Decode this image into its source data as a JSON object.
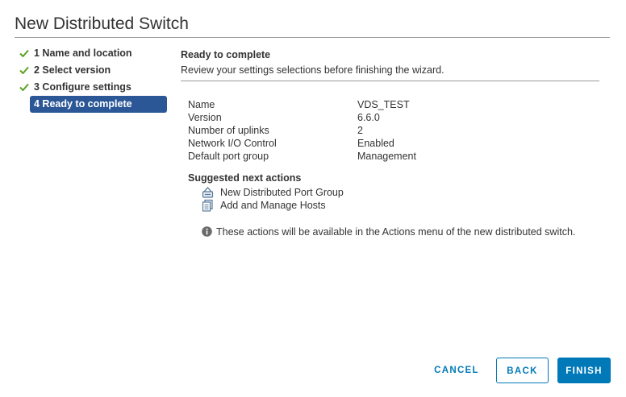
{
  "dialog": {
    "title": "New Distributed Switch"
  },
  "steps": [
    {
      "label": "1 Name and location",
      "completed": true
    },
    {
      "label": "2 Select version",
      "completed": true
    },
    {
      "label": "3 Configure settings",
      "completed": true
    },
    {
      "label": "4 Ready to complete",
      "active": true
    }
  ],
  "main": {
    "section_title": "Ready to complete",
    "section_desc": "Review your settings selections before finishing the wizard.",
    "summary": [
      {
        "key": "Name",
        "value": "VDS_TEST"
      },
      {
        "key": "Version",
        "value": "6.6.0"
      },
      {
        "key": "Number of uplinks",
        "value": "2"
      },
      {
        "key": "Network I/O Control",
        "value": "Enabled"
      },
      {
        "key": "Default port group",
        "value": "Management"
      }
    ],
    "next_actions_title": "Suggested next actions",
    "next_actions": [
      {
        "label": "New Distributed Port Group",
        "icon": "port-group-icon"
      },
      {
        "label": "Add and Manage Hosts",
        "icon": "hosts-icon"
      }
    ],
    "info_note": "These actions will be available in the Actions menu of the new distributed switch."
  },
  "buttons": {
    "cancel": "CANCEL",
    "back": "BACK",
    "finish": "FINISH"
  },
  "colors": {
    "accent": "#0079b8",
    "active_step": "#2b5797",
    "check": "#5aa220"
  }
}
